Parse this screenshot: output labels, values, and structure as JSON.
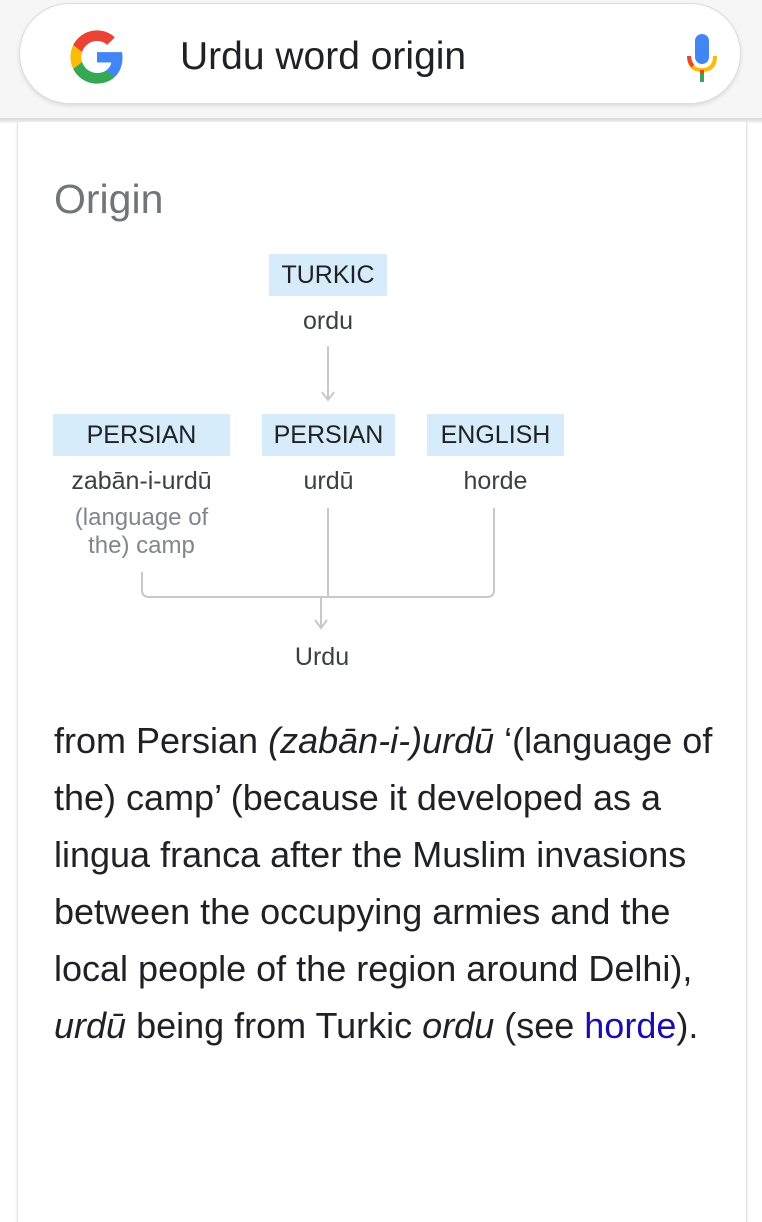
{
  "search": {
    "query": "Urdu word origin"
  },
  "icons": {
    "logo": "google-g-icon",
    "mic": "microphone-icon"
  },
  "colors": {
    "link": "#1a0dab",
    "tag_background": "#d7ecfb",
    "heading": "#70757a"
  },
  "origin": {
    "heading": "Origin",
    "diagram": {
      "top": {
        "language": "TURKIC",
        "word": "ordu"
      },
      "left": {
        "language": "PERSIAN",
        "word": "zabān-i-urdū",
        "gloss_line1": "(language of",
        "gloss_line2": "the) camp"
      },
      "middle": {
        "language": "PERSIAN",
        "word": "urdū"
      },
      "right": {
        "language": "ENGLISH",
        "word": "horde"
      },
      "result": "Urdu"
    },
    "etymology": {
      "t1": "from Persian ",
      "i1": "(zabān-i-)urdū",
      "t2": " ‘(language of the) camp’ (because it developed as a lingua franca after the Muslim invasions between the occupying armies and the local people of the region around Delhi), ",
      "i2": "urdū",
      "t3": " being from Turkic ",
      "i3": "ordu",
      "t4": " (see ",
      "link": "horde",
      "t5": ")."
    }
  }
}
